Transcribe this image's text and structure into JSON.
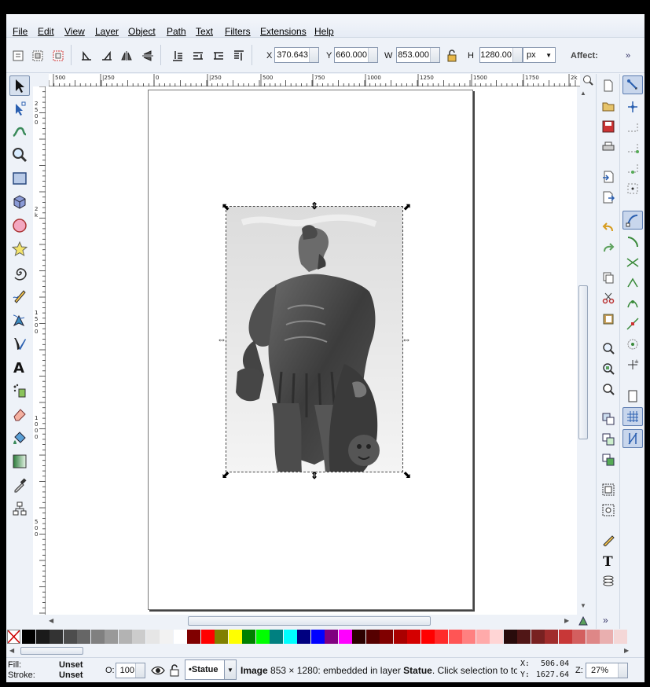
{
  "menubar": {
    "items": [
      {
        "label": "File"
      },
      {
        "label": "Edit"
      },
      {
        "label": "View"
      },
      {
        "label": "Layer"
      },
      {
        "label": "Object"
      },
      {
        "label": "Path"
      },
      {
        "label": "Text"
      },
      {
        "label": "Filters"
      },
      {
        "label": "Extensions"
      },
      {
        "label": "Help"
      }
    ]
  },
  "toolbar": {
    "x_label": "X",
    "x_value": "370.643",
    "y_label": "Y",
    "y_value": "660.000",
    "w_label": "W",
    "w_value": "853.000",
    "h_label": "H",
    "h_value": "1280.00",
    "unit": "px",
    "affect_label": "Affect:",
    "overflow": "»"
  },
  "rulers": {
    "h_ticks": [
      "500",
      "|250",
      "0",
      "|250",
      "500",
      "750",
      "1000",
      "1250",
      "1500",
      "1750",
      "2k"
    ],
    "v_ticks": [
      "2500",
      "2k",
      "1500",
      "1000",
      "500"
    ]
  },
  "canvas": {
    "image_description_alt": "Statue"
  },
  "cmdbar": {
    "overflow": "»"
  },
  "palette": {
    "colors": [
      "#000000",
      "#1a1a1a",
      "#333333",
      "#4d4d4d",
      "#666666",
      "#808080",
      "#999999",
      "#b3b3b3",
      "#cccccc",
      "#e6e6e6",
      "#f2f2f2",
      "#ffffff",
      "#800000",
      "#ff0000",
      "#808000",
      "#ffff00",
      "#008000",
      "#00ff00",
      "#008080",
      "#00ffff",
      "#000080",
      "#0000ff",
      "#800080",
      "#ff00ff",
      "#2b0000",
      "#550000",
      "#800000",
      "#aa0000",
      "#d40000",
      "#ff0000",
      "#ff2a2a",
      "#ff5555",
      "#ff8080",
      "#ffaaaa",
      "#ffd5d5",
      "#280b0b",
      "#501616",
      "#782121",
      "#a02c2c",
      "#c83737",
      "#d35f5f",
      "#de8787",
      "#e9afaf",
      "#f4d7d7"
    ]
  },
  "status": {
    "fill_label": "Fill:",
    "fill_value": "Unset",
    "stroke_label": "Stroke:",
    "stroke_value": "Unset",
    "opacity_label": "O:",
    "opacity_value": "100",
    "layer_name": "•Statue",
    "message_bold": "Image",
    "message_rest": " 853 × 1280: embedded in layer ",
    "message_layer": "Statue",
    "message_tail": ". Click selection to to...",
    "x_label": "X:",
    "x_value": "506.04",
    "y_label": "Y:",
    "y_value": "1627.64",
    "zoom_label": "Z:",
    "zoom_value": "27%"
  }
}
